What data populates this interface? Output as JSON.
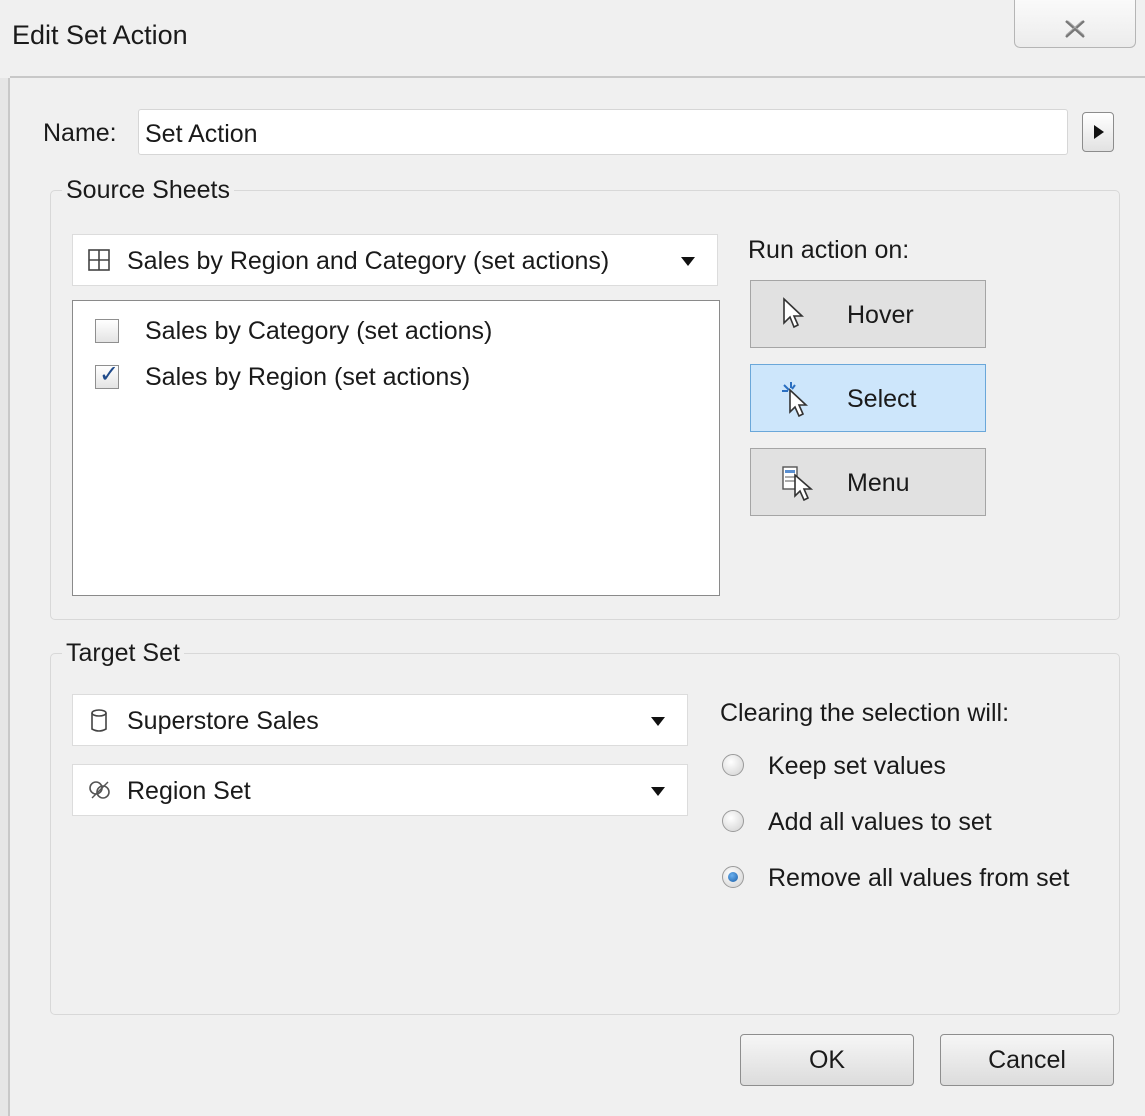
{
  "window": {
    "title": "Edit Set Action",
    "close_glyph": "✗"
  },
  "name": {
    "label": "Name:",
    "value": "Set Action"
  },
  "source_sheets": {
    "group_label": "Source Sheets",
    "dashboard_dropdown": "Sales by Region and Category (set actions)",
    "sheets": [
      {
        "label": "Sales by Category (set actions)",
        "checked": false
      },
      {
        "label": "Sales by Region  (set actions)",
        "checked": true
      }
    ]
  },
  "run_action": {
    "label": "Run action on:",
    "options": [
      {
        "label": "Hover",
        "icon": "hover-cursor-icon",
        "selected": false
      },
      {
        "label": "Select",
        "icon": "select-cursor-icon",
        "selected": true
      },
      {
        "label": "Menu",
        "icon": "menu-cursor-icon",
        "selected": false
      }
    ]
  },
  "target_set": {
    "group_label": "Target Set",
    "data_source": "Superstore Sales",
    "set": "Region Set"
  },
  "clearing": {
    "label": "Clearing the selection will:",
    "options": [
      {
        "label": "Keep set values",
        "selected": false
      },
      {
        "label": "Add all values to set",
        "selected": false
      },
      {
        "label": "Remove all values from set",
        "selected": true
      }
    ]
  },
  "footer": {
    "ok": "OK",
    "cancel": "Cancel"
  }
}
